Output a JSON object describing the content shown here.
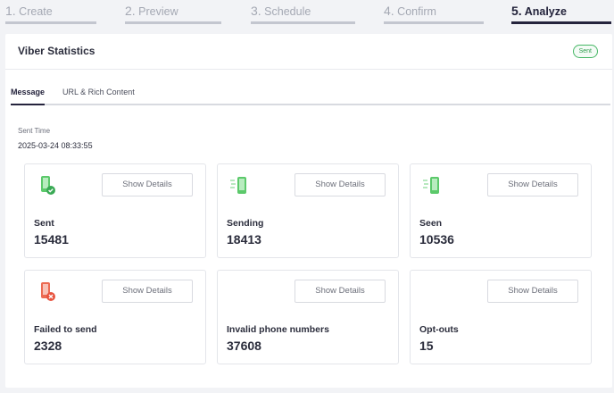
{
  "steps": [
    {
      "num": "1.",
      "label": "Create"
    },
    {
      "num": "2.",
      "label": "Preview"
    },
    {
      "num": "3.",
      "label": "Schedule"
    },
    {
      "num": "4.",
      "label": "Confirm"
    },
    {
      "num": "5.",
      "label": "Analyze"
    }
  ],
  "panel": {
    "title": "Viber Statistics",
    "badge": "Sent"
  },
  "tabs": [
    {
      "label": "Message"
    },
    {
      "label": "URL & Rich Content"
    }
  ],
  "sent_time": {
    "label": "Sent Time",
    "value": "2025-03-24 08:33:55"
  },
  "cards": [
    {
      "label": "Sent",
      "value": "15481",
      "button": "Show Details",
      "icon": "phone-check-icon"
    },
    {
      "label": "Sending",
      "value": "18413",
      "button": "Show Details",
      "icon": "phone-sending-icon"
    },
    {
      "label": "Seen",
      "value": "10536",
      "button": "Show Details",
      "icon": "phone-seen-icon"
    },
    {
      "label": "Failed to send",
      "value": "2328",
      "button": "Show Details",
      "icon": "phone-error-icon"
    },
    {
      "label": "Invalid phone numbers",
      "value": "37608",
      "button": "Show Details",
      "icon": ""
    },
    {
      "label": "Opt-outs",
      "value": "15",
      "button": "Show Details",
      "icon": ""
    }
  ],
  "colors": {
    "accent": "#25243d",
    "success": "#46b765",
    "error": "#e8543f",
    "icon_green": "#5cc96b"
  }
}
